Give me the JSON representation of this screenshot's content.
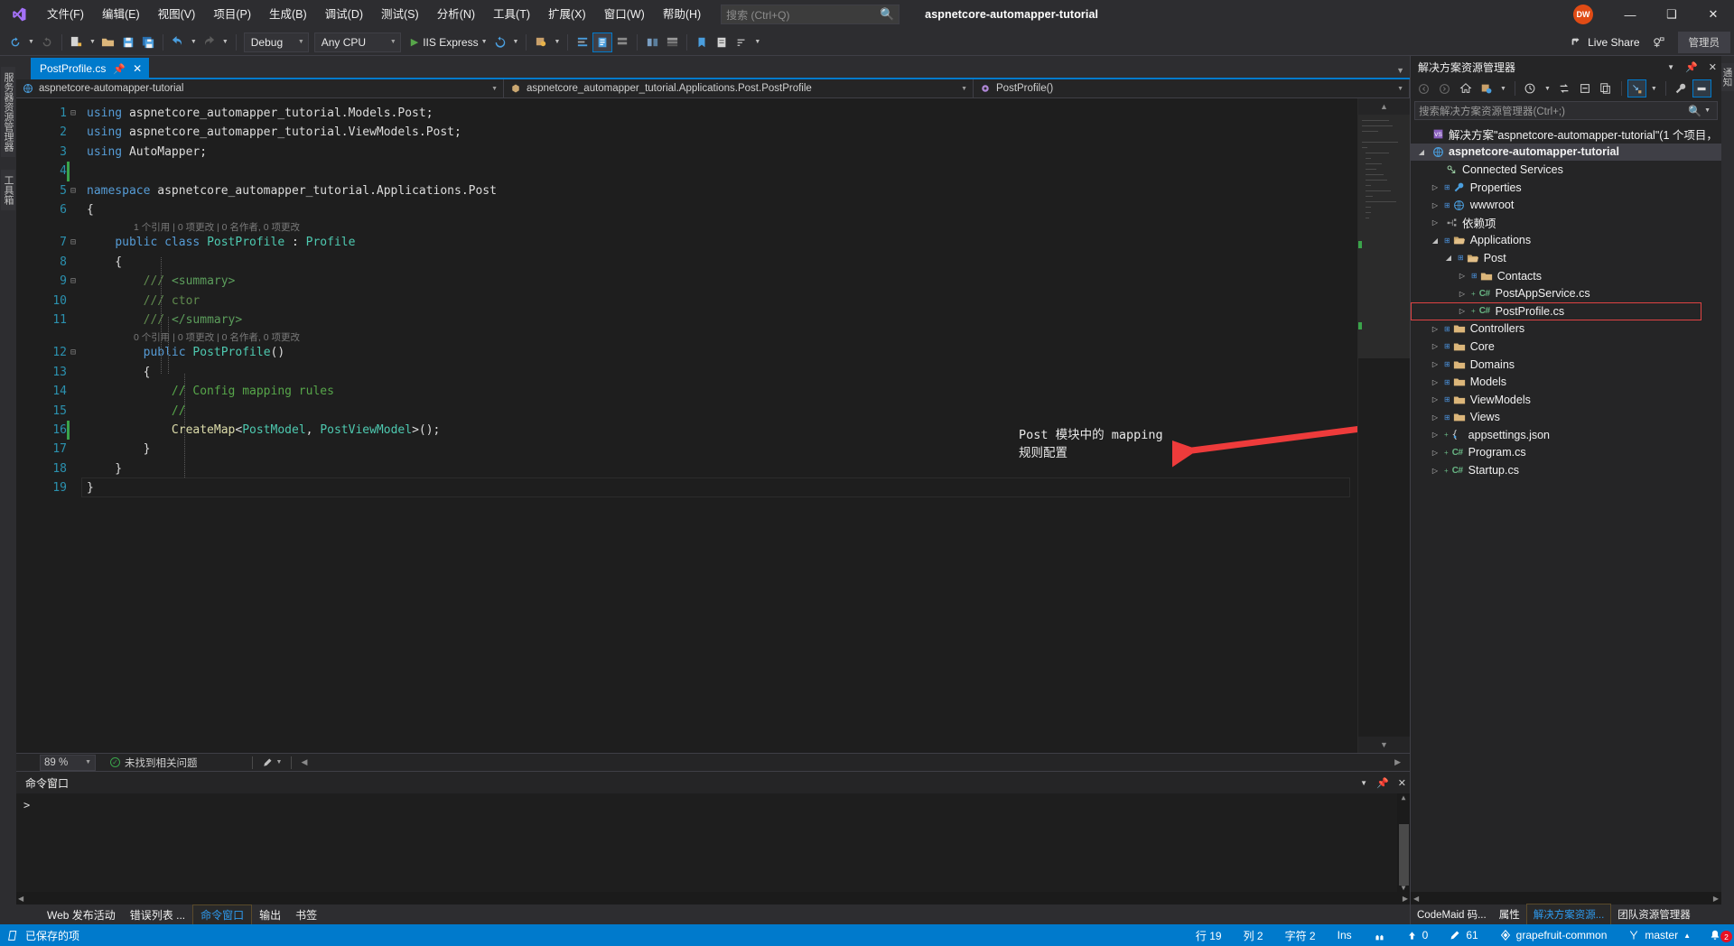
{
  "titlebar": {
    "logo_icon": "visual-studio-logo",
    "menus": [
      "文件(F)",
      "编辑(E)",
      "视图(V)",
      "项目(P)",
      "生成(B)",
      "调试(D)",
      "测试(S)",
      "分析(N)",
      "工具(T)",
      "扩展(X)",
      "窗口(W)",
      "帮助(H)"
    ],
    "search_placeholder": "搜索 (Ctrl+Q)",
    "solution_title": "aspnetcore-automapper-tutorial",
    "account_initials": "DW",
    "minimize_icon": "minimize-icon",
    "restore_icon": "restore-icon",
    "close_icon": "close-icon"
  },
  "toolbar": {
    "back_icon": "navigate-back-icon",
    "forward_icon": "navigate-forward-icon",
    "new_project_icon": "new-project-icon",
    "open_icon": "open-file-icon",
    "save_icon": "save-icon",
    "save_all_icon": "save-all-icon",
    "undo_icon": "undo-icon",
    "redo_icon": "redo-icon",
    "config_value": "Debug",
    "platform_value": "Any CPU",
    "run_label": "IIS Express",
    "restart_icon": "restart-icon",
    "live_share_label": "Live Share",
    "live_share_icon": "live-share-icon",
    "feedback_icon": "feedback-icon",
    "admin_label": "管理员"
  },
  "left_rail": {
    "tabs": [
      "服务器资源管理器",
      "工具箱"
    ]
  },
  "editor": {
    "tab_name": "PostProfile.cs",
    "tab_pin_icon": "pin-icon",
    "tab_close_icon": "close-icon",
    "breadcrumb": {
      "project": "aspnetcore-automapper-tutorial",
      "project_icon": "web-project-icon",
      "type": "aspnetcore_automapper_tutorial.Applications.Post.PostProfile",
      "type_icon": "class-icon",
      "member": "PostProfile()",
      "member_icon": "method-icon"
    },
    "lines": [
      {
        "n": 1,
        "segments": [
          {
            "t": "using ",
            "c": "k"
          },
          {
            "t": "aspnetcore_automapper_tutorial.Models.Post;",
            "c": "p"
          }
        ],
        "fold": "minus"
      },
      {
        "n": 2,
        "segments": [
          {
            "t": "using ",
            "c": "k"
          },
          {
            "t": "aspnetcore_automapper_tutorial.ViewModels.Post;",
            "c": "p"
          }
        ],
        "fold": ""
      },
      {
        "n": 3,
        "segments": [
          {
            "t": "using ",
            "c": "k"
          },
          {
            "t": "AutoMapper;",
            "c": "p"
          }
        ],
        "fold": ""
      },
      {
        "n": 4,
        "segments": [],
        "fold": ""
      },
      {
        "n": 5,
        "segments": [
          {
            "t": "namespace ",
            "c": "k"
          },
          {
            "t": "aspnetcore_automapper_tutorial.Applications.Post",
            "c": "p"
          }
        ],
        "fold": "minus"
      },
      {
        "n": 6,
        "segments": [
          {
            "t": "{",
            "c": "p"
          }
        ],
        "fold": ""
      },
      {
        "n": 7,
        "segments": [
          {
            "t": "    ",
            "c": "p"
          },
          {
            "t": "public class ",
            "c": "k"
          },
          {
            "t": "PostProfile",
            "c": "t"
          },
          {
            "t": " : ",
            "c": "p"
          },
          {
            "t": "Profile",
            "c": "t"
          }
        ],
        "fold": "minus"
      },
      {
        "n": 8,
        "segments": [
          {
            "t": "    {",
            "c": "p"
          }
        ],
        "fold": ""
      },
      {
        "n": 9,
        "segments": [
          {
            "t": "        ",
            "c": "p"
          },
          {
            "t": "/// ",
            "c": "xd"
          },
          {
            "t": "<summary>",
            "c": "xdt"
          }
        ],
        "fold": "minus"
      },
      {
        "n": 10,
        "segments": [
          {
            "t": "        ",
            "c": "p"
          },
          {
            "t": "/// ctor",
            "c": "xd"
          }
        ],
        "fold": ""
      },
      {
        "n": 11,
        "segments": [
          {
            "t": "        ",
            "c": "p"
          },
          {
            "t": "/// ",
            "c": "xd"
          },
          {
            "t": "</summary>",
            "c": "xdt"
          }
        ],
        "fold": ""
      },
      {
        "n": 12,
        "segments": [
          {
            "t": "        ",
            "c": "p"
          },
          {
            "t": "public ",
            "c": "k"
          },
          {
            "t": "PostProfile",
            "c": "t"
          },
          {
            "t": "()",
            "c": "p"
          }
        ],
        "fold": "minus"
      },
      {
        "n": 13,
        "segments": [
          {
            "t": "        {",
            "c": "p"
          }
        ],
        "fold": ""
      },
      {
        "n": 14,
        "segments": [
          {
            "t": "            ",
            "c": "p"
          },
          {
            "t": "// Config mapping rules",
            "c": "cm"
          }
        ],
        "fold": ""
      },
      {
        "n": 15,
        "segments": [
          {
            "t": "            ",
            "c": "p"
          },
          {
            "t": "//",
            "c": "cm"
          }
        ],
        "fold": ""
      },
      {
        "n": 16,
        "segments": [
          {
            "t": "            ",
            "c": "p"
          },
          {
            "t": "CreateMap",
            "c": "m"
          },
          {
            "t": "<",
            "c": "p"
          },
          {
            "t": "PostModel",
            "c": "t"
          },
          {
            "t": ", ",
            "c": "p"
          },
          {
            "t": "PostViewModel",
            "c": "t"
          },
          {
            "t": ">();",
            "c": "p"
          }
        ],
        "fold": ""
      },
      {
        "n": 17,
        "segments": [
          {
            "t": "        }",
            "c": "p"
          }
        ],
        "fold": ""
      },
      {
        "n": 18,
        "segments": [
          {
            "t": "    }",
            "c": "p"
          }
        ],
        "fold": ""
      },
      {
        "n": 19,
        "segments": [
          {
            "t": "}",
            "c": "p"
          }
        ],
        "fold": ""
      }
    ],
    "codelens": [
      {
        "after_line": 6,
        "text": "1 个引用 | 0 项更改 | 0 名作者, 0 项更改"
      },
      {
        "after_line": 11,
        "text": "0 个引用 | 0 项更改 | 0 名作者, 0 项更改"
      }
    ],
    "annotation": "Post 模块中的 mapping\n规则配置",
    "annotation_arrow_color": "#ee3b3b",
    "status": {
      "zoom": "89 %",
      "issues": "未找到相关问题",
      "issues_icon": "check-circle-icon"
    }
  },
  "bottom_panel": {
    "title": "命令窗口",
    "prompt": ">",
    "dropdown_icon": "chevron-down-icon",
    "pin_icon": "pin-icon",
    "close_icon": "close-icon",
    "tabs": [
      "Web 发布活动",
      "错误列表 ...",
      "命令窗口",
      "输出",
      "书签"
    ],
    "active_tab": "命令窗口"
  },
  "solution_explorer": {
    "title": "解决方案资源管理器",
    "dropdown_icon": "chevron-down-icon",
    "pin_icon": "pin-icon",
    "close_icon": "close-icon",
    "toolbar_icons": [
      "back-icon",
      "forward-icon",
      "home-icon",
      "pending-changes-icon",
      "history-icon",
      "sync-icon",
      "collapse-all-icon",
      "show-all-files-icon",
      "properties-icon",
      "preview-selected-icon",
      "refresh-icon"
    ],
    "search_placeholder": "搜索解决方案资源管理器(Ctrl+;)",
    "search_icon": "search-icon",
    "tree": [
      {
        "depth": 0,
        "expander": "none",
        "icon": "solution",
        "label": "解决方案\"aspnetcore-automapper-tutorial\"(1 个项目，",
        "bold": false,
        "sel": false,
        "boxed": false
      },
      {
        "depth": 0,
        "expander": "open",
        "icon": "webproject",
        "label": "aspnetcore-automapper-tutorial",
        "bold": true,
        "sel": true,
        "boxed": false
      },
      {
        "depth": 1,
        "expander": "none",
        "icon": "connected",
        "label": "Connected Services",
        "bold": false,
        "sel": false,
        "boxed": false
      },
      {
        "depth": 1,
        "expander": "closed",
        "icon": "wrench",
        "label": "Properties",
        "bold": false,
        "sel": false,
        "boxed": false
      },
      {
        "depth": 1,
        "expander": "closed",
        "icon": "globe",
        "label": "wwwroot",
        "bold": false,
        "sel": false,
        "boxed": false
      },
      {
        "depth": 1,
        "expander": "closed",
        "icon": "deps",
        "label": "依赖项",
        "bold": false,
        "sel": false,
        "boxed": false
      },
      {
        "depth": 1,
        "expander": "open",
        "icon": "folderopen",
        "label": "Applications",
        "bold": false,
        "sel": false,
        "boxed": false
      },
      {
        "depth": 2,
        "expander": "open",
        "icon": "folderopen",
        "label": "Post",
        "bold": false,
        "sel": false,
        "boxed": false
      },
      {
        "depth": 3,
        "expander": "closed",
        "icon": "folder",
        "label": "Contacts",
        "bold": false,
        "sel": false,
        "boxed": false
      },
      {
        "depth": 3,
        "expander": "closed",
        "icon": "cs",
        "label": "PostAppService.cs",
        "bold": false,
        "sel": false,
        "boxed": false
      },
      {
        "depth": 3,
        "expander": "closed",
        "icon": "cs",
        "label": "PostProfile.cs",
        "bold": false,
        "sel": false,
        "boxed": true
      },
      {
        "depth": 1,
        "expander": "closed",
        "icon": "folder",
        "label": "Controllers",
        "bold": false,
        "sel": false,
        "boxed": false
      },
      {
        "depth": 1,
        "expander": "closed",
        "icon": "folder",
        "label": "Core",
        "bold": false,
        "sel": false,
        "boxed": false
      },
      {
        "depth": 1,
        "expander": "closed",
        "icon": "folder",
        "label": "Domains",
        "bold": false,
        "sel": false,
        "boxed": false
      },
      {
        "depth": 1,
        "expander": "closed",
        "icon": "folder",
        "label": "Models",
        "bold": false,
        "sel": false,
        "boxed": false
      },
      {
        "depth": 1,
        "expander": "closed",
        "icon": "folder",
        "label": "ViewModels",
        "bold": false,
        "sel": false,
        "boxed": false
      },
      {
        "depth": 1,
        "expander": "closed",
        "icon": "folder",
        "label": "Views",
        "bold": false,
        "sel": false,
        "boxed": false
      },
      {
        "depth": 1,
        "expander": "closed",
        "icon": "json",
        "label": "appsettings.json",
        "bold": false,
        "sel": false,
        "boxed": false
      },
      {
        "depth": 1,
        "expander": "closed",
        "icon": "cs",
        "label": "Program.cs",
        "bold": false,
        "sel": false,
        "boxed": false
      },
      {
        "depth": 1,
        "expander": "closed",
        "icon": "cs",
        "label": "Startup.cs",
        "bold": false,
        "sel": false,
        "boxed": false
      }
    ],
    "tabs": [
      "CodeMaid 码...",
      "属性",
      "解决方案资源...",
      "团队资源管理器"
    ],
    "active_tab": "解决方案资源...",
    "right_rail_tab": "通知"
  },
  "statusbar": {
    "saved_label": "已保存的项",
    "saved_icon": "document-icon",
    "line_label": "行 19",
    "column_label": "列 2",
    "char_label": "字符 2",
    "insert_label": "Ins",
    "codemaid_icon": "codemaid-icon",
    "up_icon": "arrow-up-icon",
    "up_count": "0",
    "pencil_icon": "pencil-icon",
    "pencil_count": "61",
    "repo_icon": "repository-icon",
    "repo_name": "grapefruit-common",
    "branch_icon": "branch-icon",
    "branch_name": "master",
    "branch_caret": "▲",
    "notify_icon": "bell-icon",
    "notify_count": "2",
    "accent": "#007acc"
  }
}
